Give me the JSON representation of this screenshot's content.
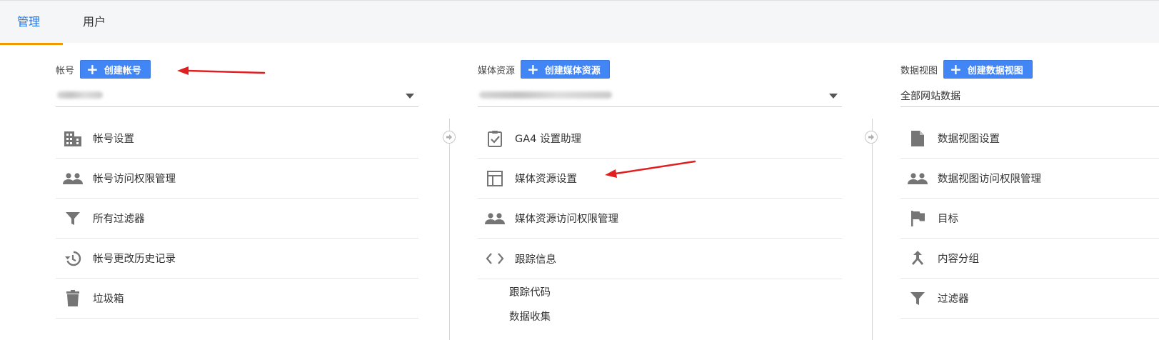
{
  "tabs": {
    "admin": "管理",
    "user": "用户"
  },
  "account": {
    "label": "帐号",
    "create_label": "创建帐号",
    "items": [
      {
        "label": "帐号设置",
        "icon": "building-icon"
      },
      {
        "label": "帐号访问权限管理",
        "icon": "people-icon"
      },
      {
        "label": "所有过滤器",
        "icon": "filter-icon"
      },
      {
        "label": "帐号更改历史记录",
        "icon": "history-icon"
      },
      {
        "label": "垃圾箱",
        "icon": "trash-icon"
      }
    ]
  },
  "property": {
    "label": "媒体资源",
    "create_label": "创建媒体资源",
    "items": [
      {
        "label": "GA4 设置助理",
        "icon": "clipboard-check-icon"
      },
      {
        "label": "媒体资源设置",
        "icon": "layout-icon"
      },
      {
        "label": "媒体资源访问权限管理",
        "icon": "people-icon"
      },
      {
        "label": "跟踪信息",
        "icon": "code-icon"
      }
    ],
    "sub_items": [
      "跟踪代码",
      "数据收集"
    ]
  },
  "view": {
    "label": "数据视图",
    "create_label": "创建数据视图",
    "selected": "全部网站数据",
    "items": [
      {
        "label": "数据视图设置",
        "icon": "document-icon"
      },
      {
        "label": "数据视图访问权限管理",
        "icon": "people-icon"
      },
      {
        "label": "目标",
        "icon": "flag-icon"
      },
      {
        "label": "内容分组",
        "icon": "merge-icon"
      },
      {
        "label": "过滤器",
        "icon": "filter-icon"
      }
    ]
  },
  "colors": {
    "accent": "#4285f4",
    "tab_active": "#1a73e8",
    "tab_underline": "#f29900",
    "annotation": "#e02020",
    "icon": "#757575"
  }
}
